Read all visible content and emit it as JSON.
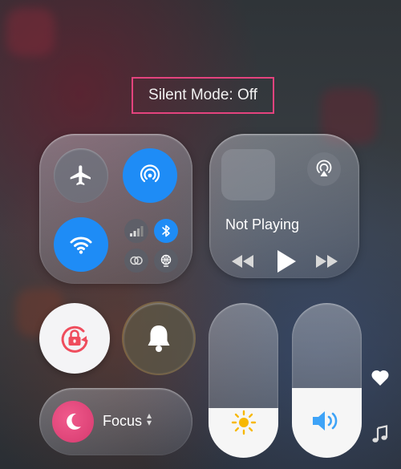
{
  "status": {
    "silent_mode_text": "Silent Mode: Off"
  },
  "connectivity": {
    "airplane": {
      "icon": "airplane-icon",
      "state": "off"
    },
    "airdrop": {
      "icon": "airdrop-icon",
      "state": "on"
    },
    "wifi": {
      "icon": "wifi-icon",
      "state": "on"
    },
    "cellular": {
      "icon": "cellular-signal-icon",
      "state": "off"
    },
    "bluetooth": {
      "icon": "bluetooth-icon",
      "state": "on"
    },
    "link": {
      "icon": "link-icon",
      "state": "off"
    },
    "hotspot": {
      "icon": "globe-icon",
      "state": "off"
    }
  },
  "media": {
    "now_playing": "Not Playing",
    "airplay_icon": "airplay-audio-icon",
    "controls": [
      "rewind-icon",
      "play-icon",
      "fast-forward-icon"
    ]
  },
  "toggles": {
    "orientation_lock": {
      "icon": "orientation-lock-icon",
      "state": "on"
    },
    "silent": {
      "icon": "bell-icon",
      "state": "off"
    }
  },
  "sliders": {
    "brightness": {
      "icon": "sun-icon",
      "level": 0.32
    },
    "volume": {
      "icon": "speaker-icon",
      "level": 0.45
    }
  },
  "focus": {
    "label": "Focus",
    "icon": "moon-icon"
  },
  "side": {
    "heart_icon": "heart-icon",
    "music_icon": "music-note-icon"
  },
  "colors": {
    "accent_blue": "#1e8cf6",
    "lock_red": "#ef4d5d",
    "highlight_pink": "#e4437e",
    "sun_yellow": "#f7b800",
    "speaker_blue": "#3ea3f7"
  }
}
